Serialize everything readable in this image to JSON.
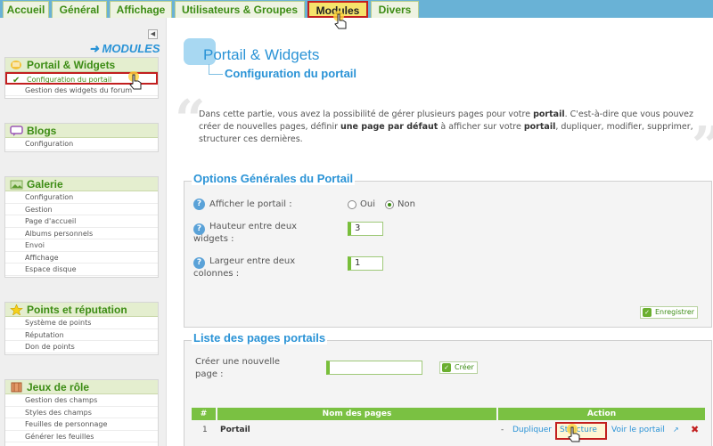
{
  "tabs": [
    {
      "label": "Accueil"
    },
    {
      "label": "Général"
    },
    {
      "label": "Affichage"
    },
    {
      "label": "Utilisateurs & Groupes"
    },
    {
      "label": "Modules"
    },
    {
      "label": "Divers"
    }
  ],
  "sidebar": {
    "title": "MODULES",
    "sections": [
      {
        "title": "Portail & Widgets",
        "items": [
          "Configuration du portail",
          "Gestion des widgets du forum"
        ]
      },
      {
        "title": "Blogs",
        "items": [
          "Configuration"
        ]
      },
      {
        "title": "Galerie",
        "items": [
          "Configuration",
          "Gestion",
          "Page d'accueil",
          "Albums personnels",
          "Envoi",
          "Affichage",
          "Espace disque"
        ]
      },
      {
        "title": "Points et réputation",
        "items": [
          "Système de points",
          "Réputation",
          "Don de points"
        ]
      },
      {
        "title": "Jeux de rôle",
        "items": [
          "Gestion des champs",
          "Styles des champs",
          "Feuilles de personnage",
          "Générer les feuilles"
        ]
      }
    ]
  },
  "main": {
    "title": "Portail & Widgets",
    "subtitle": "Configuration du portail",
    "intro_1": "Dans cette partie, vous avez la possibilité de gérer plusieurs pages pour votre ",
    "intro_b1": "portail",
    "intro_2": ". C'est-à-dire que vous pouvez créer de nouvelles pages, définir ",
    "intro_b2": "une page par défaut",
    "intro_3": " à afficher sur votre ",
    "intro_b3": "portail",
    "intro_4": ", dupliquer, modifier, supprimer, structurer ces dernières.",
    "options": {
      "legend": "Options Générales du Portail",
      "show_label": "Afficher le portail :",
      "oui": "Oui",
      "non": "Non",
      "height_label_1": "Hauteur entre deux",
      "height_label_2": "widgets :",
      "height_value": "3",
      "width_label_1": "Largeur entre deux",
      "width_label_2": "colonnes :",
      "width_value": "1",
      "save": "Enregistrer"
    },
    "pages": {
      "legend": "Liste des pages portails",
      "create_label_1": "Créer une nouvelle",
      "create_label_2": "page :",
      "create_value": "",
      "create_button": "Créer",
      "col_num": "#",
      "col_name": "Nom des pages",
      "col_action": "Action",
      "rows": [
        {
          "num": "1",
          "name": "Portail",
          "dash": "-",
          "dup": "Dupliquer",
          "struct": "Structure",
          "view": "Voir le portail"
        }
      ]
    }
  }
}
